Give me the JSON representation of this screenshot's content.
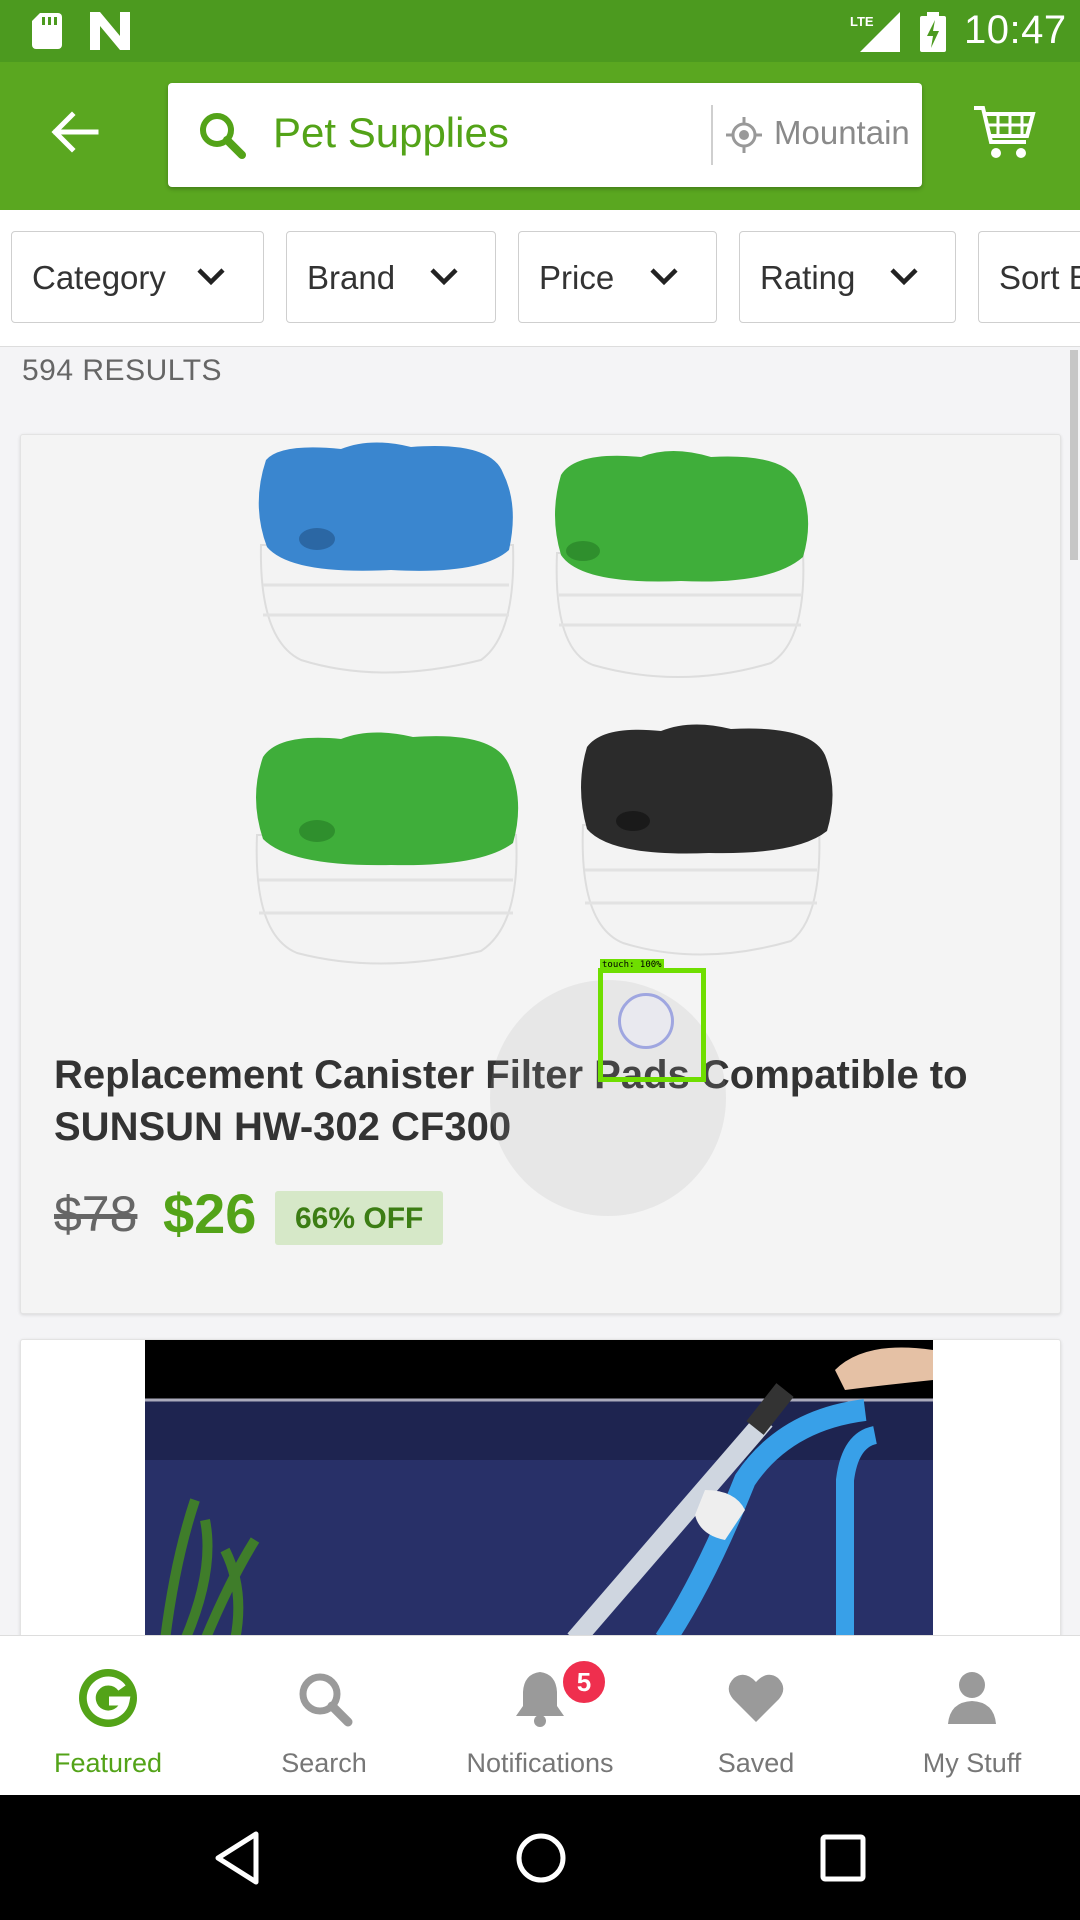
{
  "status_bar": {
    "time": "10:47",
    "network": "LTE"
  },
  "search": {
    "query": "Pet Supplies",
    "location": "Mountain View"
  },
  "filters": [
    {
      "label": "Category"
    },
    {
      "label": "Brand"
    },
    {
      "label": "Price"
    },
    {
      "label": "Rating"
    },
    {
      "label": "Sort By"
    }
  ],
  "results": {
    "count_text": "594 RESULTS",
    "items": [
      {
        "title": "Replacement Canister Filter Pads Compatible to SUNSUN HW-302 CF300",
        "old_price": "$78",
        "price": "$26",
        "discount": "66% OFF"
      }
    ]
  },
  "touch_overlay": {
    "label": "touch: 100%"
  },
  "bottom_nav": {
    "items": [
      {
        "label": "Featured",
        "icon": "featured-g-icon",
        "active": true
      },
      {
        "label": "Search",
        "icon": "search-icon"
      },
      {
        "label": "Notifications",
        "icon": "bell-icon",
        "badge": "5"
      },
      {
        "label": "Saved",
        "icon": "heart-icon"
      },
      {
        "label": "My Stuff",
        "icon": "person-icon"
      }
    ]
  },
  "colors": {
    "status_bar": "#4c9a1f",
    "app_bar": "#5aa720",
    "accent": "#53a318",
    "badge": "#ef2f4e"
  }
}
